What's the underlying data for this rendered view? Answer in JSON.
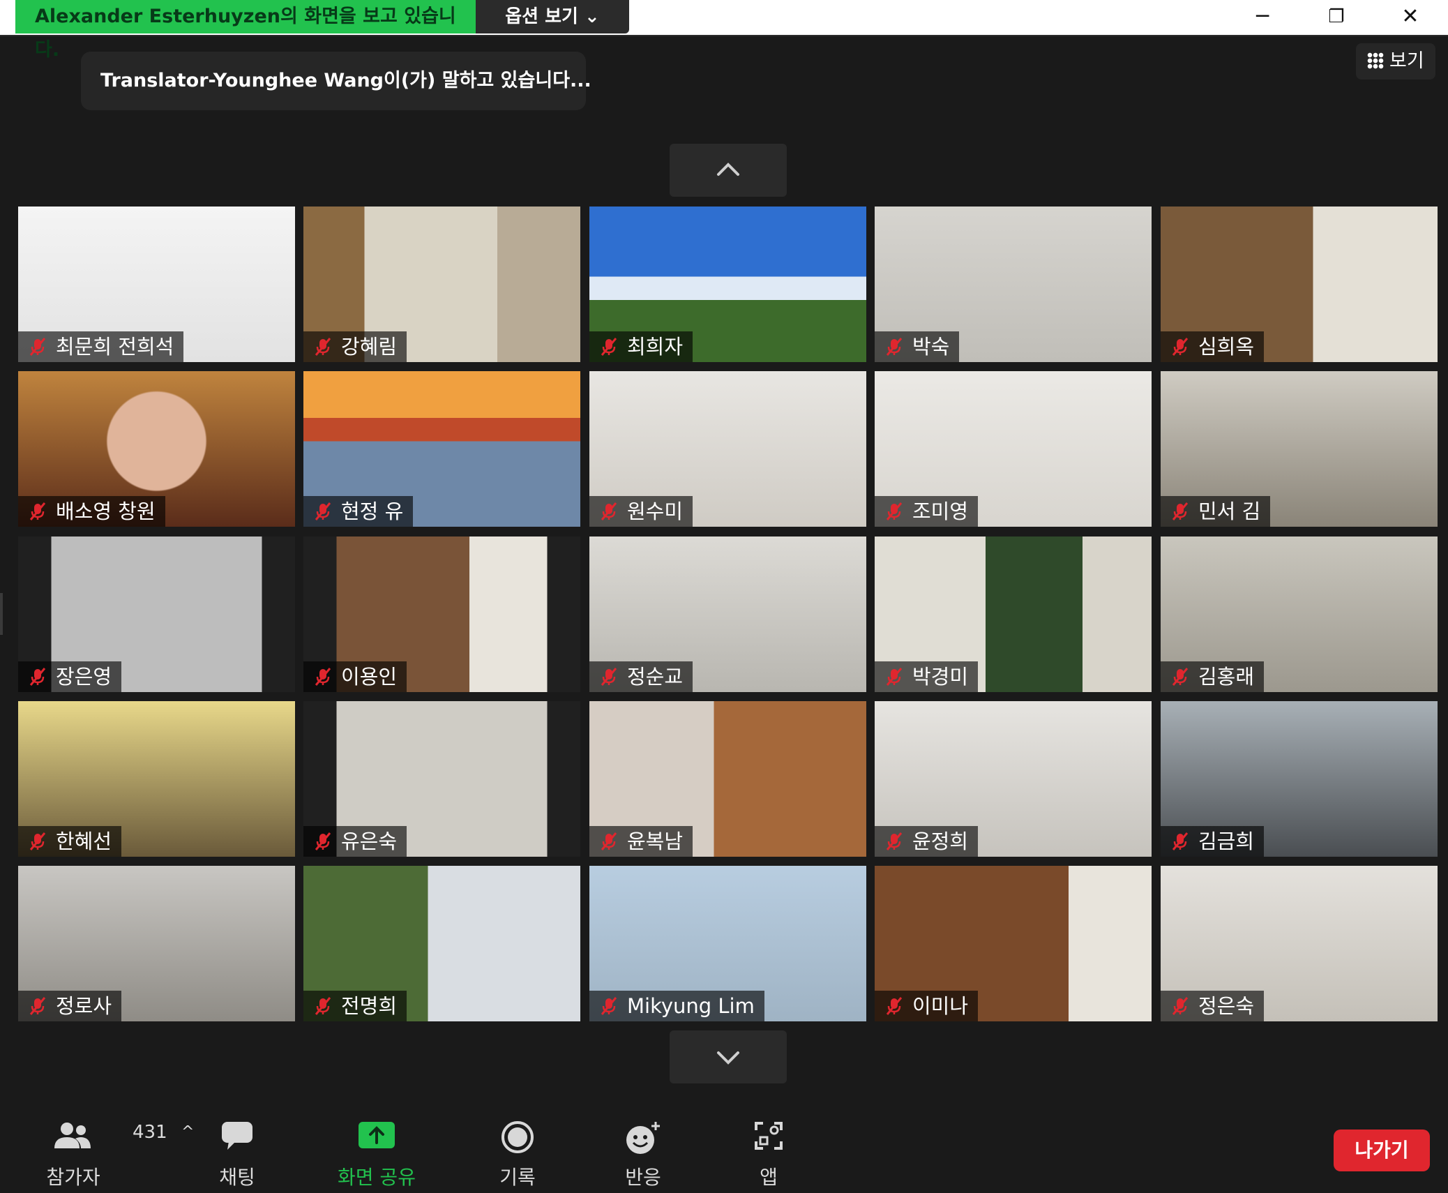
{
  "window": {
    "share_banner": "Alexander  Esterhuyzen의 화면을 보고 있습니다.",
    "view_options": "옵션 보기 ⌄",
    "minimize": "─",
    "restore": "❐",
    "close": "✕"
  },
  "speaking_banner": "Translator-Younghee  Wang이(가) 말하고 있습니다...",
  "view_button": "보기",
  "participants": [
    {
      "name": "최문희 전희석"
    },
    {
      "name": "강혜림"
    },
    {
      "name": "최희자"
    },
    {
      "name": "박숙"
    },
    {
      "name": "심희옥"
    },
    {
      "name": "배소영 창원"
    },
    {
      "name": "현정 유"
    },
    {
      "name": "원수미"
    },
    {
      "name": "조미영"
    },
    {
      "name": "민서 김"
    },
    {
      "name": "장은영"
    },
    {
      "name": "이용인"
    },
    {
      "name": "정순교"
    },
    {
      "name": "박경미"
    },
    {
      "name": "김홍래"
    },
    {
      "name": "한혜선"
    },
    {
      "name": "유은숙"
    },
    {
      "name": "윤복남"
    },
    {
      "name": "윤정희"
    },
    {
      "name": "김금희"
    },
    {
      "name": "정로사"
    },
    {
      "name": "전명희"
    },
    {
      "name": "Mikyung Lim"
    },
    {
      "name": "이미나"
    },
    {
      "name": "정은숙"
    }
  ],
  "toolbar": {
    "participants_label": "참가자",
    "participants_count": "431",
    "caret": "^",
    "chat_label": "채팅",
    "share_label": "화면 공유",
    "record_label": "기록",
    "reactions_label": "반응",
    "apps_label": "앱",
    "leave_label": "나가기"
  },
  "colors": {
    "share_green": "#22c24e",
    "leave_red": "#e0262e",
    "mic_muted": "#e0262e"
  }
}
